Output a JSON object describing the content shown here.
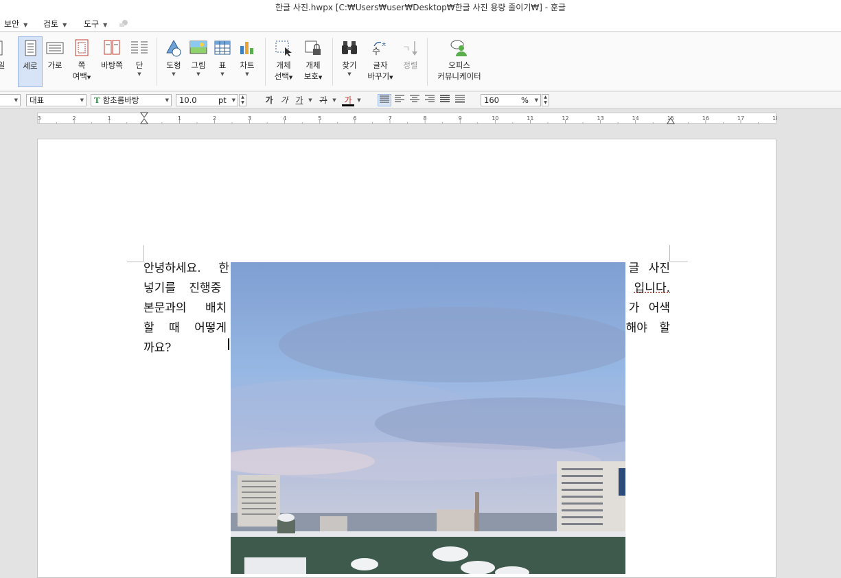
{
  "window": {
    "title": "한글 사진.hwpx [C:₩Users₩user₩Desktop₩한글 사진 용량 줄이기₩] - 훈글"
  },
  "menu": {
    "items": [
      "보안",
      "검토",
      "도구"
    ]
  },
  "ribbon": {
    "partial_left": "일",
    "buttons": [
      {
        "label": "세로"
      },
      {
        "label": "가로"
      },
      {
        "label": "쪽",
        "label2": "여백"
      },
      {
        "label": "바탕쪽"
      },
      {
        "label": "단"
      },
      {
        "label": "도형"
      },
      {
        "label": "그림"
      },
      {
        "label": "표"
      },
      {
        "label": "차트"
      },
      {
        "label": "개체",
        "label2": "선택"
      },
      {
        "label": "개체",
        "label2": "보호"
      },
      {
        "label": "찾기"
      },
      {
        "label": "글자",
        "label2": "바꾸기"
      },
      {
        "label": "정렬"
      },
      {
        "label": "오피스",
        "label2": "커뮤니케이터"
      }
    ]
  },
  "format": {
    "style": "대표",
    "font": "함초롬바탕",
    "font_icon": "T",
    "size_value": "10.0",
    "size_unit": "pt",
    "bold": "가",
    "italic": "가",
    "underline": "가",
    "strike": "가",
    "color": "가",
    "zoom_value": "160",
    "zoom_unit": "%"
  },
  "ruler": {
    "numbers": [
      "3",
      "2",
      "1",
      "",
      "1",
      "2",
      "3",
      "4",
      "5",
      "6",
      "7",
      "8",
      "9",
      "10",
      "11",
      "12",
      "13",
      "14",
      "15",
      "16",
      "17",
      "18"
    ]
  },
  "document": {
    "lines_left": [
      "안녕하세요. 한",
      "넣기를 진행중",
      "본문과의 배치",
      "할 때 어떻게",
      "까요?"
    ],
    "lines_right": [
      "글 사진",
      "입니다.",
      "가 어색",
      "해야 할",
      ""
    ]
  },
  "colors": {
    "accent": "#d7e4f7",
    "page_bg": "#e3e3e3"
  }
}
